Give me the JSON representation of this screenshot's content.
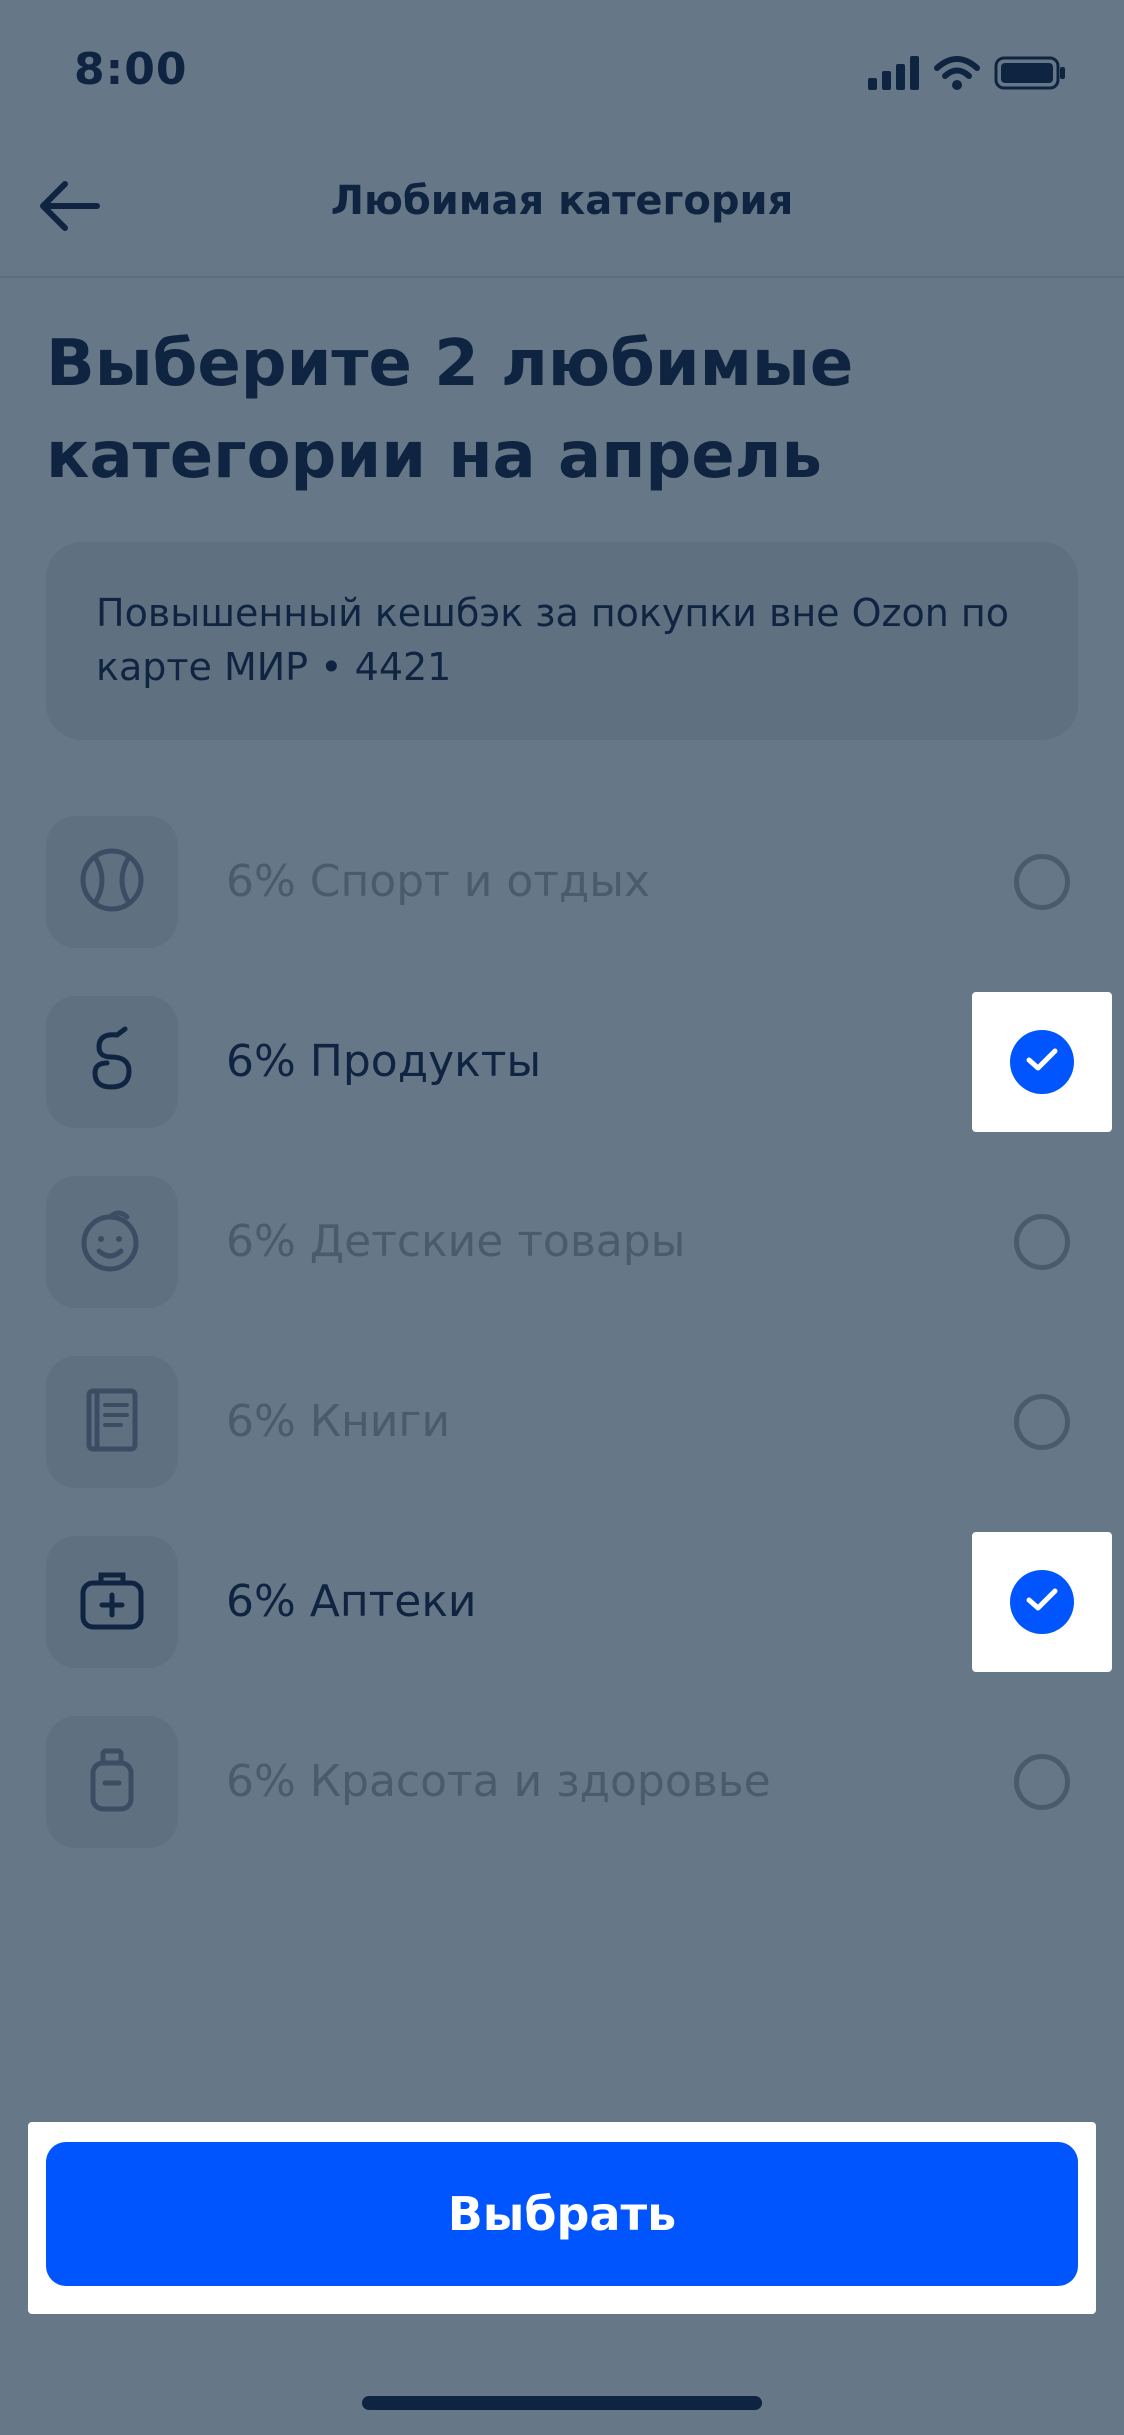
{
  "status_bar": {
    "time": "8:00"
  },
  "nav": {
    "title": "Любимая категория"
  },
  "page": {
    "title": "Выберите 2 любимые категории на апрель"
  },
  "info": {
    "text": "Повышенный кешбэк за покупки вне Ozon по карте МИР • 4421"
  },
  "categories": [
    {
      "label": "6% Спорт и отдых",
      "icon": "sport-ball-icon",
      "selected": false
    },
    {
      "label": "6% Продукты",
      "icon": "groceries-icon",
      "selected": true
    },
    {
      "label": "6% Детские товары",
      "icon": "baby-face-icon",
      "selected": false
    },
    {
      "label": "6% Книги",
      "icon": "book-icon",
      "selected": false
    },
    {
      "label": "6% Аптеки",
      "icon": "pharmacy-kit-icon",
      "selected": true
    },
    {
      "label": "6% Красота и здоровье",
      "icon": "cosmetics-bottle-icon",
      "selected": false
    }
  ],
  "actions": {
    "select_label": "Выбрать"
  },
  "colors": {
    "accent": "#0055ff",
    "text": "#0f2440",
    "overlay_bg": "#667788"
  }
}
